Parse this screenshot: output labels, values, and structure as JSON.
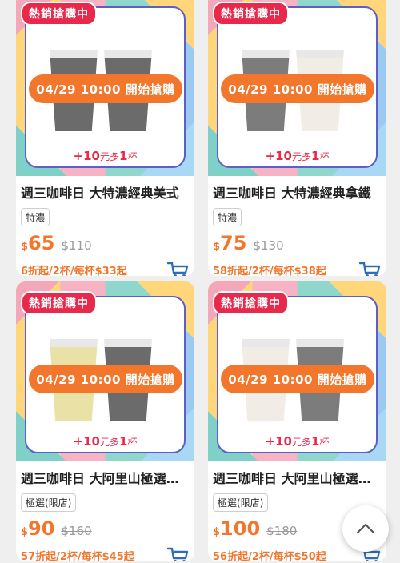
{
  "colors": {
    "accent": "#f2762c",
    "badge": "#e8294b",
    "cart": "#2d6fb7"
  },
  "products": [
    {
      "badge": "熱銷搶購中",
      "sale_start": "04/29 10:00 開始搶購",
      "bonus_prefix": "+10",
      "bonus_suffix": "元多",
      "bonus_num": "1",
      "bonus_unit": "杯",
      "name": "週三咖啡日 大特濃經典美式",
      "tag": "特濃",
      "currency": "$",
      "price": "65",
      "orig_price": "$110",
      "subnote": "6折起/2杯/每杯$33起"
    },
    {
      "badge": "熱銷搶購中",
      "sale_start": "04/29 10:00 開始搶購",
      "bonus_prefix": "+10",
      "bonus_suffix": "元多",
      "bonus_num": "1",
      "bonus_unit": "杯",
      "name": "週三咖啡日 大特濃經典拿鐵",
      "tag": "特濃",
      "currency": "$",
      "price": "75",
      "orig_price": "$130",
      "subnote": "58折起/2杯/每杯$38起"
    },
    {
      "badge": "熱銷搶購中",
      "sale_start": "04/29 10:00 開始搶購",
      "bonus_prefix": "+10",
      "bonus_suffix": "元多",
      "bonus_num": "1",
      "bonus_unit": "杯",
      "name": "週三咖啡日 大阿里山極選美式",
      "tag": "極選(限店)",
      "currency": "$",
      "price": "90",
      "orig_price": "$160",
      "subnote": "57折起/2杯/每杯$45起"
    },
    {
      "badge": "熱銷搶購中",
      "sale_start": "04/29 10:00 開始搶購",
      "bonus_prefix": "+10",
      "bonus_suffix": "元多",
      "bonus_num": "1",
      "bonus_unit": "杯",
      "name": "週三咖啡日 大阿里山極選拿鐵",
      "tag": "極選(限店)",
      "currency": "$",
      "price": "100",
      "orig_price": "$180",
      "subnote": "56折起/2杯/每杯$50起"
    }
  ],
  "icons": {
    "cart": "cart-icon",
    "scroll_top": "chevron-up-icon"
  }
}
